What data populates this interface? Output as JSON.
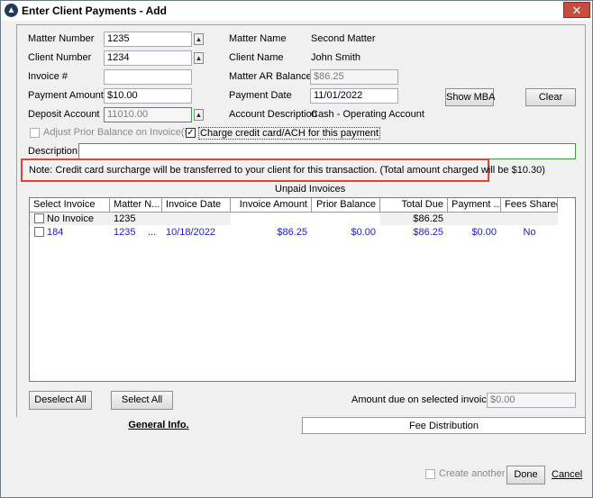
{
  "window": {
    "title": "Enter Client Payments - Add",
    "close_glyph": "✕"
  },
  "form": {
    "matter_number": {
      "label": "Matter Number",
      "value": "1235"
    },
    "client_number": {
      "label": "Client Number",
      "value": "1234"
    },
    "invoice_no": {
      "label": "Invoice #",
      "value": ""
    },
    "payment_amount": {
      "label": "Payment Amount",
      "value": "$10.00"
    },
    "deposit_account": {
      "label": "Deposit Account",
      "value": "11010.00"
    },
    "matter_name": {
      "label": "Matter Name",
      "value": "Second Matter"
    },
    "client_name": {
      "label": "Client Name",
      "value": "John Smith"
    },
    "matter_ar_balance": {
      "label": "Matter AR Balance",
      "value": "$86.25"
    },
    "payment_date": {
      "label": "Payment Date",
      "value": "11/01/2022"
    },
    "account_description": {
      "label": "Account Description",
      "value": "Cash - Operating Account"
    },
    "adjust_prior_balance": {
      "label": "Adjust Prior Balance on Invoice(s)",
      "checked": false
    },
    "charge_card": {
      "label": "Charge credit card/ACH for this payment",
      "checked": true
    },
    "description": {
      "label": "Description",
      "value": ""
    },
    "note": "Note: Credit card surcharge will be transferred to your client for this transaction. (Total amount charged will be $10.30)",
    "show_mba_label": "Show MBA",
    "clear_label": "Clear",
    "spin_glyph": "▲"
  },
  "invoices": {
    "title": "Unpaid Invoices",
    "columns": [
      "Select Invoice",
      "Matter N...",
      "Invoice Date",
      "Invoice Amount",
      "Prior Balance",
      "Total Due",
      "Payment ...",
      "Fees Shared"
    ],
    "rows": [
      {
        "select": "No Invoice",
        "matter": "1235",
        "date": "",
        "amount": "",
        "prior": "",
        "total": "$86.25",
        "payment": "",
        "fees": "",
        "checked": false
      },
      {
        "select": "184",
        "matter": "1235",
        "ellipsis": "...",
        "date": "10/18/2022",
        "amount": "$86.25",
        "prior": "$0.00",
        "total": "$86.25",
        "payment": "$0.00",
        "fees": "No",
        "checked": false
      }
    ]
  },
  "actions": {
    "deselect_all": "Deselect All",
    "select_all": "Select All",
    "amount_due_label": "Amount due on selected invoice(s)",
    "amount_due_value": "$0.00"
  },
  "tabs": {
    "general": "General Info.",
    "fee_distribution": "Fee Distribution"
  },
  "footer": {
    "create_another": "Create another",
    "done": "Done",
    "cancel": "Cancel"
  },
  "colors": {
    "accent_red": "#d8433a",
    "link_blue": "#1a1acc",
    "title_close": "#c74b3e"
  }
}
